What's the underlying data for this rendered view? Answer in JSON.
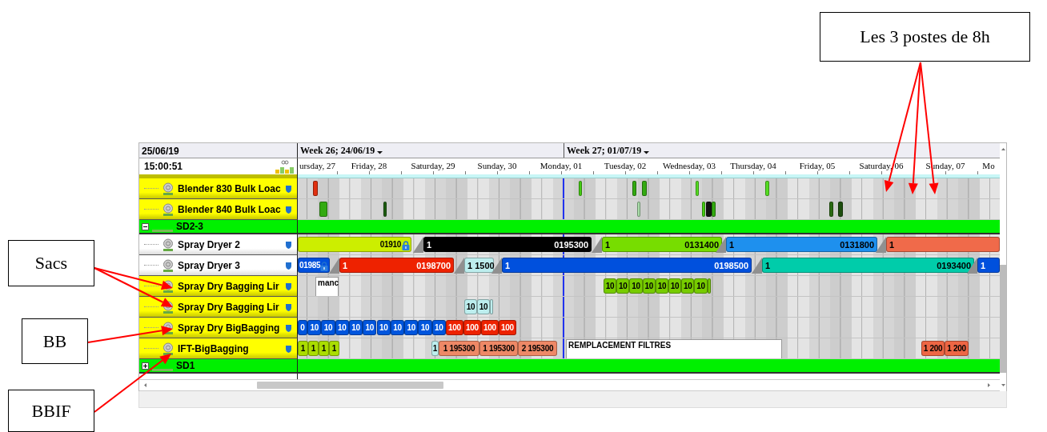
{
  "header": {
    "date": "25/06/19",
    "time": "15:00:51",
    "weeks": [
      {
        "label": "Week 26; 24/06/19"
      },
      {
        "label": "Week 27; 01/07/19"
      }
    ],
    "days": [
      "ursday, 27",
      "Friday, 28",
      "Saturday, 29",
      "Sunday, 30",
      "Monday, 01",
      "Tuesday, 02",
      "Wednesday, 03",
      "Thursday, 04",
      "Friday, 05",
      "Saturday, 06",
      "Sunday, 07",
      "Mo"
    ]
  },
  "resources": [
    {
      "kind": "resource",
      "name": "Blender 830 Bulk Loac",
      "color": "#ffff00",
      "tasks": [
        {
          "kind": "mark",
          "color": "#e03010"
        },
        {
          "kind": "mark",
          "color": "#44cc11"
        },
        {
          "kind": "mark",
          "color": "#33aa11"
        },
        {
          "kind": "mark",
          "color": "#33aa11"
        },
        {
          "kind": "mark",
          "color": "#55dd22"
        },
        {
          "kind": "mark",
          "color": "#55dd22"
        }
      ]
    },
    {
      "kind": "resource",
      "name": "Blender 840 Bulk Loac",
      "color": "#ffff00",
      "tasks": [
        {
          "kind": "mark",
          "color": "#33aa11"
        },
        {
          "kind": "mark",
          "color": "#1d5e10"
        },
        {
          "kind": "mark",
          "color": "#aaddaa"
        },
        {
          "kind": "mark",
          "color": "#44cc11"
        },
        {
          "kind": "mark",
          "color": "#111111"
        },
        {
          "kind": "mark",
          "color": "#33aa11"
        },
        {
          "kind": "mark",
          "color": "#2a6a12"
        },
        {
          "kind": "mark",
          "color": "#1d4e0e"
        }
      ]
    },
    {
      "kind": "group",
      "name": "SD2-3",
      "expanded": true
    },
    {
      "kind": "resource",
      "name": "Spray Dryer 2",
      "color": "#ffffff",
      "tasks": [
        {
          "kind": "bar",
          "end": "01910",
          "color": "#ccee00",
          "locked": true
        },
        {
          "kind": "bar",
          "start": "1",
          "end": "0195300",
          "color": "#000000",
          "locked": false
        },
        {
          "kind": "bar",
          "start": "1",
          "end": "0131400",
          "color": "#77dd00",
          "locked": false
        },
        {
          "kind": "bar",
          "start": "1",
          "end": "0131800",
          "color": "#1e90ee",
          "locked": false
        },
        {
          "kind": "bar",
          "start": "1",
          "color": "#f06a4a",
          "locked": false
        }
      ]
    },
    {
      "kind": "resource",
      "name": "Spray Dryer 3",
      "color": "#ffffff",
      "tasks": [
        {
          "kind": "bar",
          "end": "01985",
          "color": "#0050dd",
          "locked": true
        },
        {
          "kind": "bar",
          "start": "1",
          "end": "0198700",
          "color": "#ee2200",
          "locked": false
        },
        {
          "kind": "bar",
          "start": "1 1500",
          "color": "#bdeeee",
          "locked": false
        },
        {
          "kind": "bar",
          "start": "1",
          "end": "0198500",
          "color": "#0050dd",
          "locked": false
        },
        {
          "kind": "bar",
          "start": "1",
          "end": "0193400",
          "color": "#00ccaa",
          "locked": false
        },
        {
          "kind": "bar",
          "start": "1",
          "color": "#0050dd",
          "locked": false
        }
      ]
    },
    {
      "kind": "resource",
      "name": "Spray Dry Bagging Lir",
      "color": "#ffff00",
      "tasks": [
        {
          "kind": "note",
          "text": "manc"
        },
        {
          "kind": "chip",
          "text": "10",
          "color": "#77cc00"
        },
        {
          "kind": "chip",
          "text": "10",
          "color": "#77cc00"
        },
        {
          "kind": "chip",
          "text": "10",
          "color": "#77cc00"
        },
        {
          "kind": "chip",
          "text": "10",
          "color": "#77cc00"
        },
        {
          "kind": "chip",
          "text": "10",
          "color": "#77cc00"
        },
        {
          "kind": "chip",
          "text": "10",
          "color": "#77cc00"
        },
        {
          "kind": "chip",
          "text": "10",
          "color": "#77cc00"
        },
        {
          "kind": "chip",
          "text": "10",
          "color": "#77cc00"
        },
        {
          "kind": "mark",
          "color": "#77cc00"
        }
      ]
    },
    {
      "kind": "resource",
      "name": "Spray Dry Bagging Lir",
      "color": "#ffff00",
      "tasks": [
        {
          "kind": "chip",
          "text": "10",
          "color": "#bdeeee"
        },
        {
          "kind": "chip",
          "text": "10",
          "color": "#bdeeee"
        },
        {
          "kind": "mark",
          "color": "#bdeeee"
        }
      ]
    },
    {
      "kind": "resource",
      "name": "Spray Dry BigBagging",
      "color": "#ffff00",
      "tasks": [
        {
          "kind": "chip",
          "text": "0",
          "color": "#0055dd"
        },
        {
          "kind": "chip",
          "text": "10",
          "color": "#0055dd"
        },
        {
          "kind": "chip",
          "text": "10",
          "color": "#0055dd"
        },
        {
          "kind": "chip",
          "text": "10",
          "color": "#0055dd"
        },
        {
          "kind": "chip",
          "text": "10",
          "color": "#0055dd"
        },
        {
          "kind": "chip",
          "text": "10",
          "color": "#0055dd"
        },
        {
          "kind": "chip",
          "text": "10",
          "color": "#0055dd"
        },
        {
          "kind": "chip",
          "text": "10",
          "color": "#0055dd"
        },
        {
          "kind": "chip",
          "text": "10",
          "color": "#0055dd"
        },
        {
          "kind": "chip",
          "text": "10",
          "color": "#0055dd"
        },
        {
          "kind": "chip",
          "text": "10",
          "color": "#0055dd"
        },
        {
          "kind": "chip",
          "text": "100",
          "color": "#ee2200"
        },
        {
          "kind": "chip",
          "text": "100",
          "color": "#ee2200"
        },
        {
          "kind": "chip",
          "text": "100",
          "color": "#ee2200"
        },
        {
          "kind": "chip",
          "text": "100",
          "color": "#ee2200"
        }
      ]
    },
    {
      "kind": "resource",
      "name": "IFT-BigBagging",
      "color": "#ffff00",
      "tasks": [
        {
          "kind": "chip",
          "text": "1",
          "color": "#aadd00"
        },
        {
          "kind": "chip",
          "text": "1",
          "color": "#aadd00"
        },
        {
          "kind": "chip",
          "text": "1",
          "color": "#aadd00"
        },
        {
          "kind": "chip",
          "text": "1",
          "color": "#aadd00"
        },
        {
          "kind": "chip",
          "text": "1",
          "color": "#bdeeee"
        },
        {
          "kind": "chip",
          "text": "1 195300",
          "color": "#ee8866"
        },
        {
          "kind": "chip",
          "text": "1 195300",
          "color": "#ee8866"
        },
        {
          "kind": "chip",
          "text": "2 195300",
          "color": "#ee8866"
        },
        {
          "kind": "note",
          "text": "REMPLACEMENT FILTRES"
        },
        {
          "kind": "chip",
          "text": "1 200",
          "color": "#ee6644"
        },
        {
          "kind": "chip",
          "text": "1 200",
          "color": "#ee6644"
        }
      ]
    },
    {
      "kind": "group",
      "name": "SD1",
      "expanded": false
    }
  ],
  "annotations": [
    {
      "text": "Les 3 postes de 8h"
    },
    {
      "text": "Sacs"
    },
    {
      "text": "BB"
    },
    {
      "text": "BBIF"
    }
  ]
}
